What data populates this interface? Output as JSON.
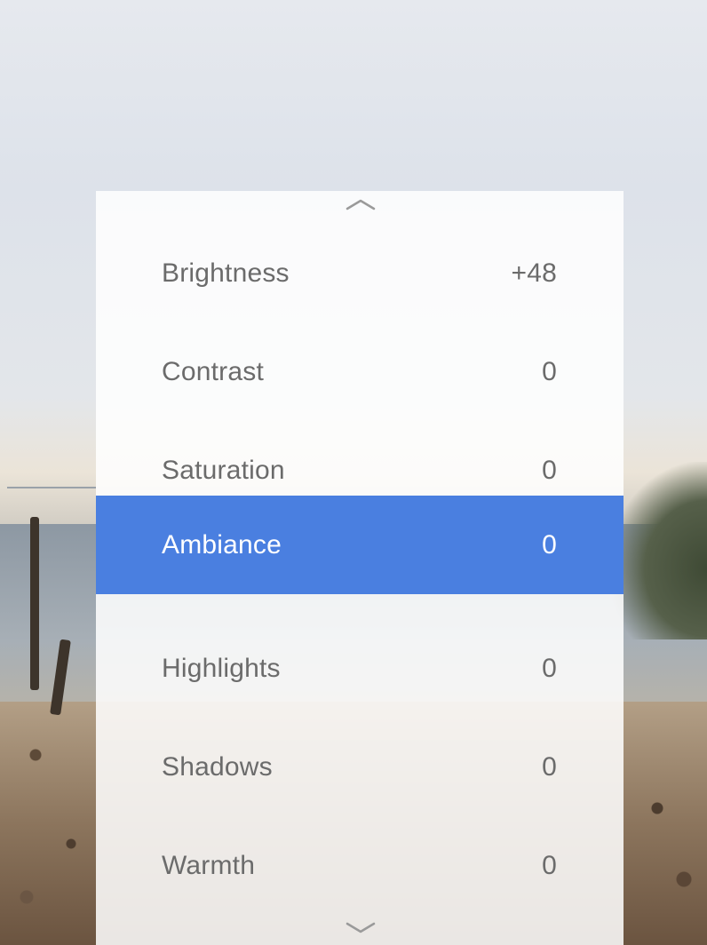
{
  "panel": {
    "scroll_up_icon": "chevron-up-icon",
    "scroll_down_icon": "chevron-down-icon",
    "items": [
      {
        "label": "Brightness",
        "value": "+48",
        "selected": false
      },
      {
        "label": "Contrast",
        "value": "0",
        "selected": false
      },
      {
        "label": "Saturation",
        "value": "0",
        "selected": false
      },
      {
        "label": "Ambiance",
        "value": "0",
        "selected": true
      },
      {
        "label": "Highlights",
        "value": "0",
        "selected": false
      },
      {
        "label": "Shadows",
        "value": "0",
        "selected": false
      },
      {
        "label": "Warmth",
        "value": "0",
        "selected": false
      }
    ]
  },
  "colors": {
    "selected_background": "#4a7fe0",
    "selected_text": "#ffffff",
    "item_text": "#6b6b6b",
    "panel_background": "#ffffff"
  }
}
